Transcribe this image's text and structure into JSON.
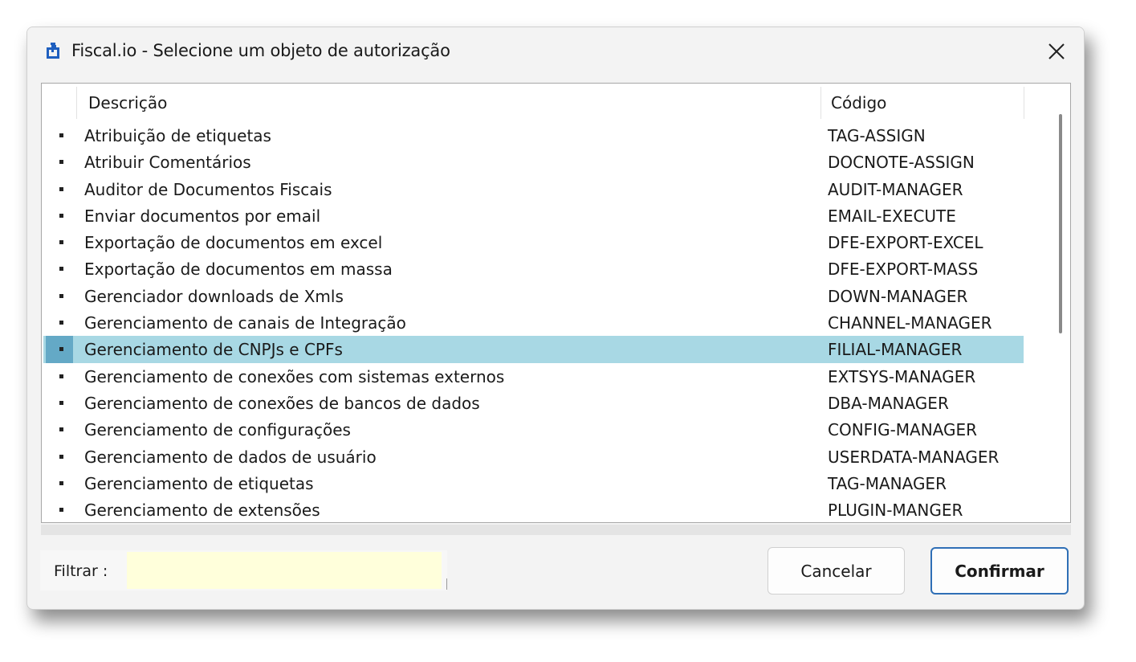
{
  "window": {
    "title": "Fiscal.io - Selecione um objeto de autorização"
  },
  "table": {
    "columns": {
      "description": "Descrição",
      "code": "Código"
    },
    "rows": [
      {
        "description": "Atribuição de etiquetas",
        "code": "TAG-ASSIGN",
        "selected": false
      },
      {
        "description": "Atribuir Comentários",
        "code": "DOCNOTE-ASSIGN",
        "selected": false
      },
      {
        "description": "Auditor de Documentos Fiscais",
        "code": "AUDIT-MANAGER",
        "selected": false
      },
      {
        "description": "Enviar documentos por email",
        "code": "EMAIL-EXECUTE",
        "selected": false
      },
      {
        "description": "Exportação de documentos em excel",
        "code": "DFE-EXPORT-EXCEL",
        "selected": false
      },
      {
        "description": "Exportação de documentos em massa",
        "code": "DFE-EXPORT-MASS",
        "selected": false
      },
      {
        "description": "Gerenciador downloads de Xmls",
        "code": "DOWN-MANAGER",
        "selected": false
      },
      {
        "description": "Gerenciamento de canais de Integração",
        "code": "CHANNEL-MANAGER",
        "selected": false
      },
      {
        "description": "Gerenciamento de CNPJs e CPFs",
        "code": "FILIAL-MANAGER",
        "selected": true
      },
      {
        "description": "Gerenciamento de conexões com sistemas externos",
        "code": "EXTSYS-MANAGER",
        "selected": false
      },
      {
        "description": "Gerenciamento de conexões de bancos de dados",
        "code": "DBA-MANAGER",
        "selected": false
      },
      {
        "description": "Gerenciamento de configurações",
        "code": "CONFIG-MANAGER",
        "selected": false
      },
      {
        "description": "Gerenciamento de dados de usuário",
        "code": "USERDATA-MANAGER",
        "selected": false
      },
      {
        "description": "Gerenciamento de etiquetas",
        "code": "TAG-MANAGER",
        "selected": false
      },
      {
        "description": "Gerenciamento de extensões",
        "code": "PLUGIN-MANGER",
        "selected": false
      }
    ]
  },
  "filter": {
    "label": "Filtrar :",
    "value": ""
  },
  "buttons": {
    "cancel": "Cancelar",
    "confirm": "Confirmar"
  },
  "colors": {
    "selected_row": "#a8d8e4",
    "filter_input": "#ffffdb",
    "confirm_border": "#2f6fb6",
    "app_icon": "#1f5fbf"
  },
  "icons": {
    "app": "fiscal-io-app-icon",
    "close": "close-icon"
  }
}
